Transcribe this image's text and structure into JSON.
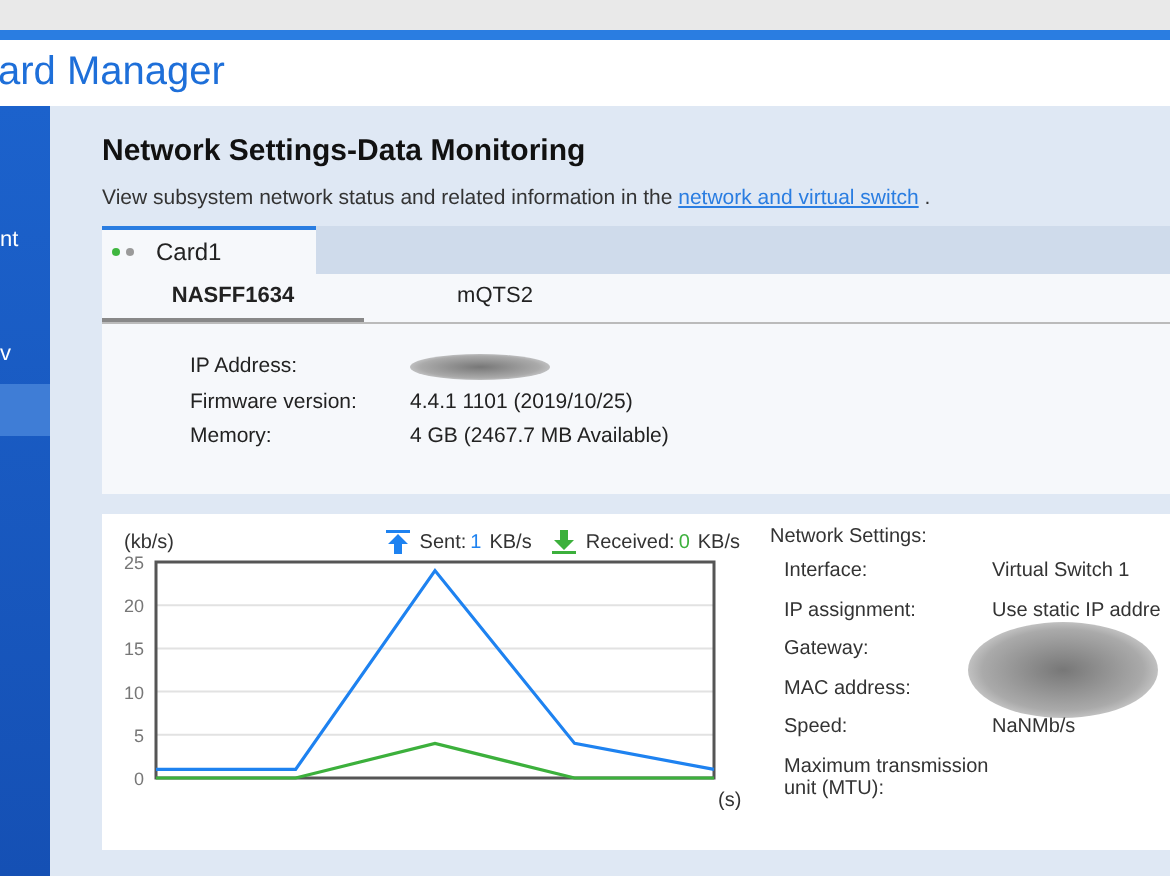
{
  "app_title": "ard Manager",
  "sidebar": {
    "items": [
      {
        "label": "nt",
        "selected": false
      },
      {
        "label": "v",
        "selected": false
      },
      {
        "selected": true
      }
    ]
  },
  "page": {
    "heading": "Network Settings-Data Monitoring",
    "description": "View subsystem network status and related information in the",
    "link": "network and virtual switch",
    "description_end": "."
  },
  "card_tab": {
    "label": "Card1",
    "selected": true,
    "status_dots": [
      {
        "color": "#3fb63f"
      },
      {
        "color": "#9a9a9a"
      }
    ]
  },
  "subtabs": [
    {
      "label": "NASFF1634",
      "selected": true
    },
    {
      "label": "mQTS2",
      "selected": false
    }
  ],
  "info": [
    {
      "label": "IP Address:",
      "redacted": true
    },
    {
      "label": "Firmware version:",
      "value": "4.4.1 1101 (2019/10/25)"
    },
    {
      "label": "Memory:",
      "value": "4 GB (2467.7 MB Available)"
    }
  ],
  "legend": [
    {
      "kind": "sent",
      "value": "1",
      "unit": "KB/s"
    },
    {
      "kind": "received",
      "value": "0",
      "unit": "KB/s"
    }
  ],
  "chart_data": {
    "type": "line",
    "grid": true,
    "legend": "top right",
    "ylabel": "(kb/s)",
    "xlabel": "(s)",
    "ylim": [
      0,
      25
    ],
    "yticks": [
      0,
      5,
      10,
      15,
      20,
      25
    ],
    "series": [
      {
        "name": "Sent:",
        "color": "#1e82f0",
        "values": [
          1,
          1,
          24,
          4,
          1
        ]
      },
      {
        "name": "Received:",
        "color": "#3cb03c",
        "values": [
          0,
          0,
          4,
          0,
          0
        ]
      }
    ]
  },
  "network_settings": {
    "title": "Network Settings:",
    "rows": [
      {
        "label": "Interface:",
        "value": "Virtual Switch 1"
      },
      {
        "label": "IP assignment:",
        "value": "Use static IP addre"
      },
      {
        "label": "Gateway:",
        "redacted": true
      },
      {
        "label": "MAC address:"
      },
      {
        "label": "Speed:",
        "value": "NaNMb/s"
      },
      {
        "label": "Maximum transmission unit (MTU):"
      }
    ]
  }
}
